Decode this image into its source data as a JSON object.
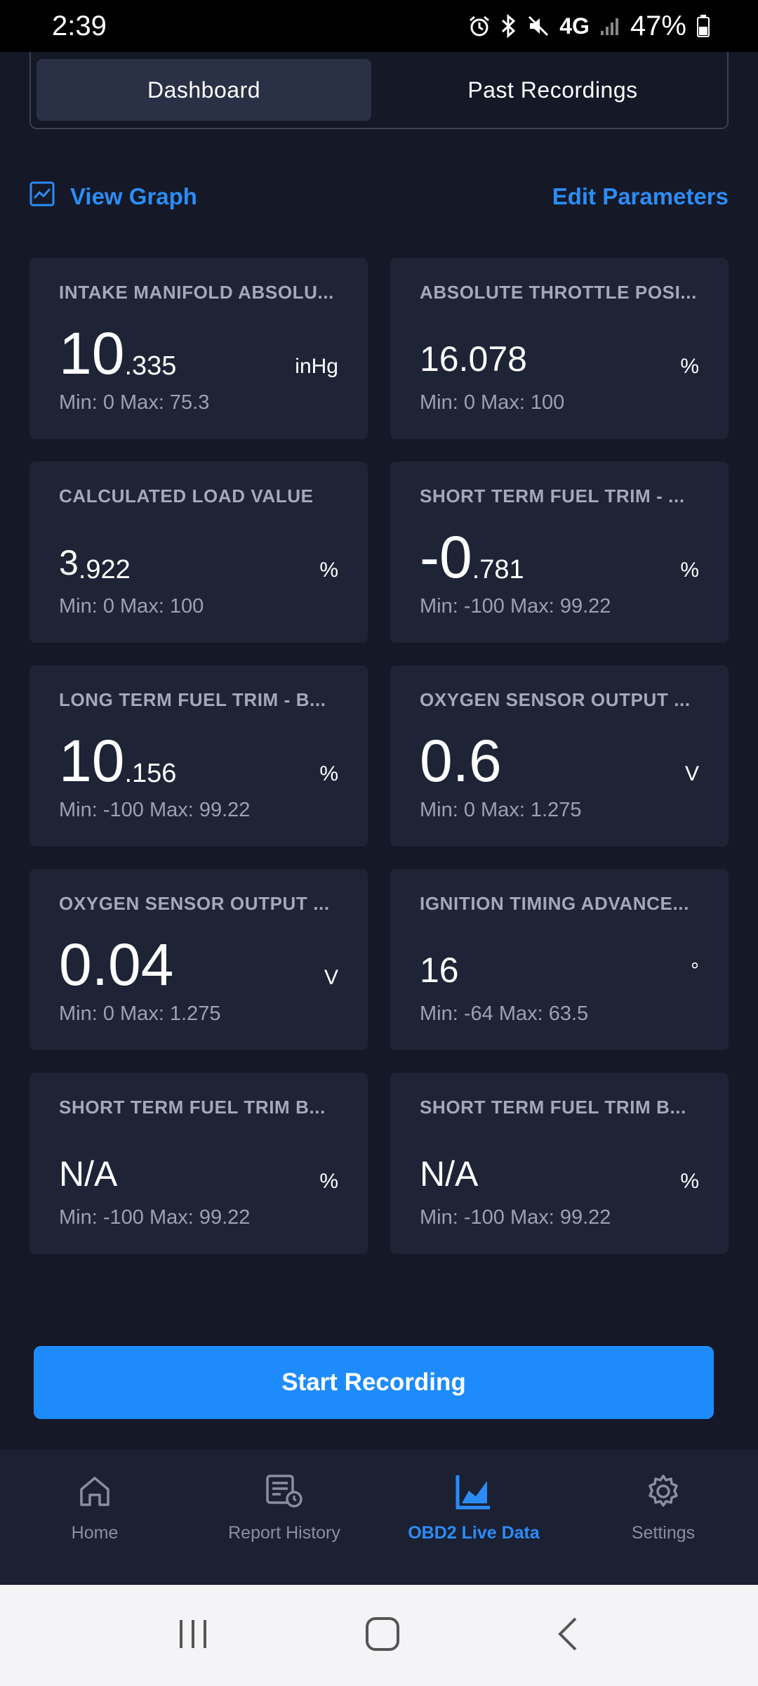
{
  "status_bar": {
    "time": "2:39",
    "network": "4G",
    "battery": "47%"
  },
  "tabs": [
    {
      "label": "Dashboard",
      "active": true
    },
    {
      "label": "Past Recordings",
      "active": false
    }
  ],
  "actions": {
    "view_graph": "View Graph",
    "edit_parameters": "Edit Parameters"
  },
  "cards": [
    {
      "title": "INTAKE MANIFOLD ABSOLU...",
      "int": "10",
      "dec": ".335",
      "unit": "inHg",
      "minmax": "Min: 0 Max: 75.3"
    },
    {
      "title": "ABSOLUTE THROTTLE POSI...",
      "int": "16.078",
      "dec": "",
      "unit": "%",
      "minmax": "Min: 0 Max: 100"
    },
    {
      "title": "CALCULATED LOAD VALUE",
      "int": "3",
      "dec": ".922",
      "unit": "%",
      "minmax": "Min: 0 Max: 100"
    },
    {
      "title": "SHORT TERM FUEL TRIM - ...",
      "int": "-0",
      "dec": ".781",
      "unit": "%",
      "minmax": "Min: -100 Max: 99.22"
    },
    {
      "title": "LONG TERM FUEL TRIM - B...",
      "int": "10",
      "dec": ".156",
      "unit": "%",
      "minmax": "Min: -100 Max: 99.22"
    },
    {
      "title": "OXYGEN SENSOR OUTPUT ...",
      "int": "0.6",
      "dec": "",
      "unit": "V",
      "minmax": "Min: 0 Max: 1.275"
    },
    {
      "title": "OXYGEN SENSOR OUTPUT ...",
      "int": "0.04",
      "dec": "",
      "unit": "V",
      "minmax": "Min: 0 Max: 1.275"
    },
    {
      "title": "IGNITION TIMING ADVANCE...",
      "int": "16",
      "dec": "",
      "unit": "°",
      "minmax": "Min: -64 Max: 63.5"
    },
    {
      "title": "SHORT TERM FUEL TRIM B...",
      "int": "N/A",
      "dec": "",
      "unit": "%",
      "minmax": "Min: -100 Max: 99.22"
    },
    {
      "title": "SHORT TERM FUEL TRIM B...",
      "int": "N/A",
      "dec": "",
      "unit": "%",
      "minmax": "Min: -100 Max: 99.22"
    }
  ],
  "start_button": "Start Recording",
  "bottom_nav": [
    {
      "label": "Home",
      "icon": "home-icon",
      "active": false
    },
    {
      "label": "Report History",
      "icon": "report-history-icon",
      "active": false
    },
    {
      "label": "OBD2 Live Data",
      "icon": "live-data-chart-icon",
      "active": true
    },
    {
      "label": "Settings",
      "icon": "gear-icon",
      "active": false
    }
  ],
  "colors": {
    "background": "#141827",
    "card": "#1e2336",
    "accent": "#1d8bfb",
    "link": "#2c8cf5"
  }
}
